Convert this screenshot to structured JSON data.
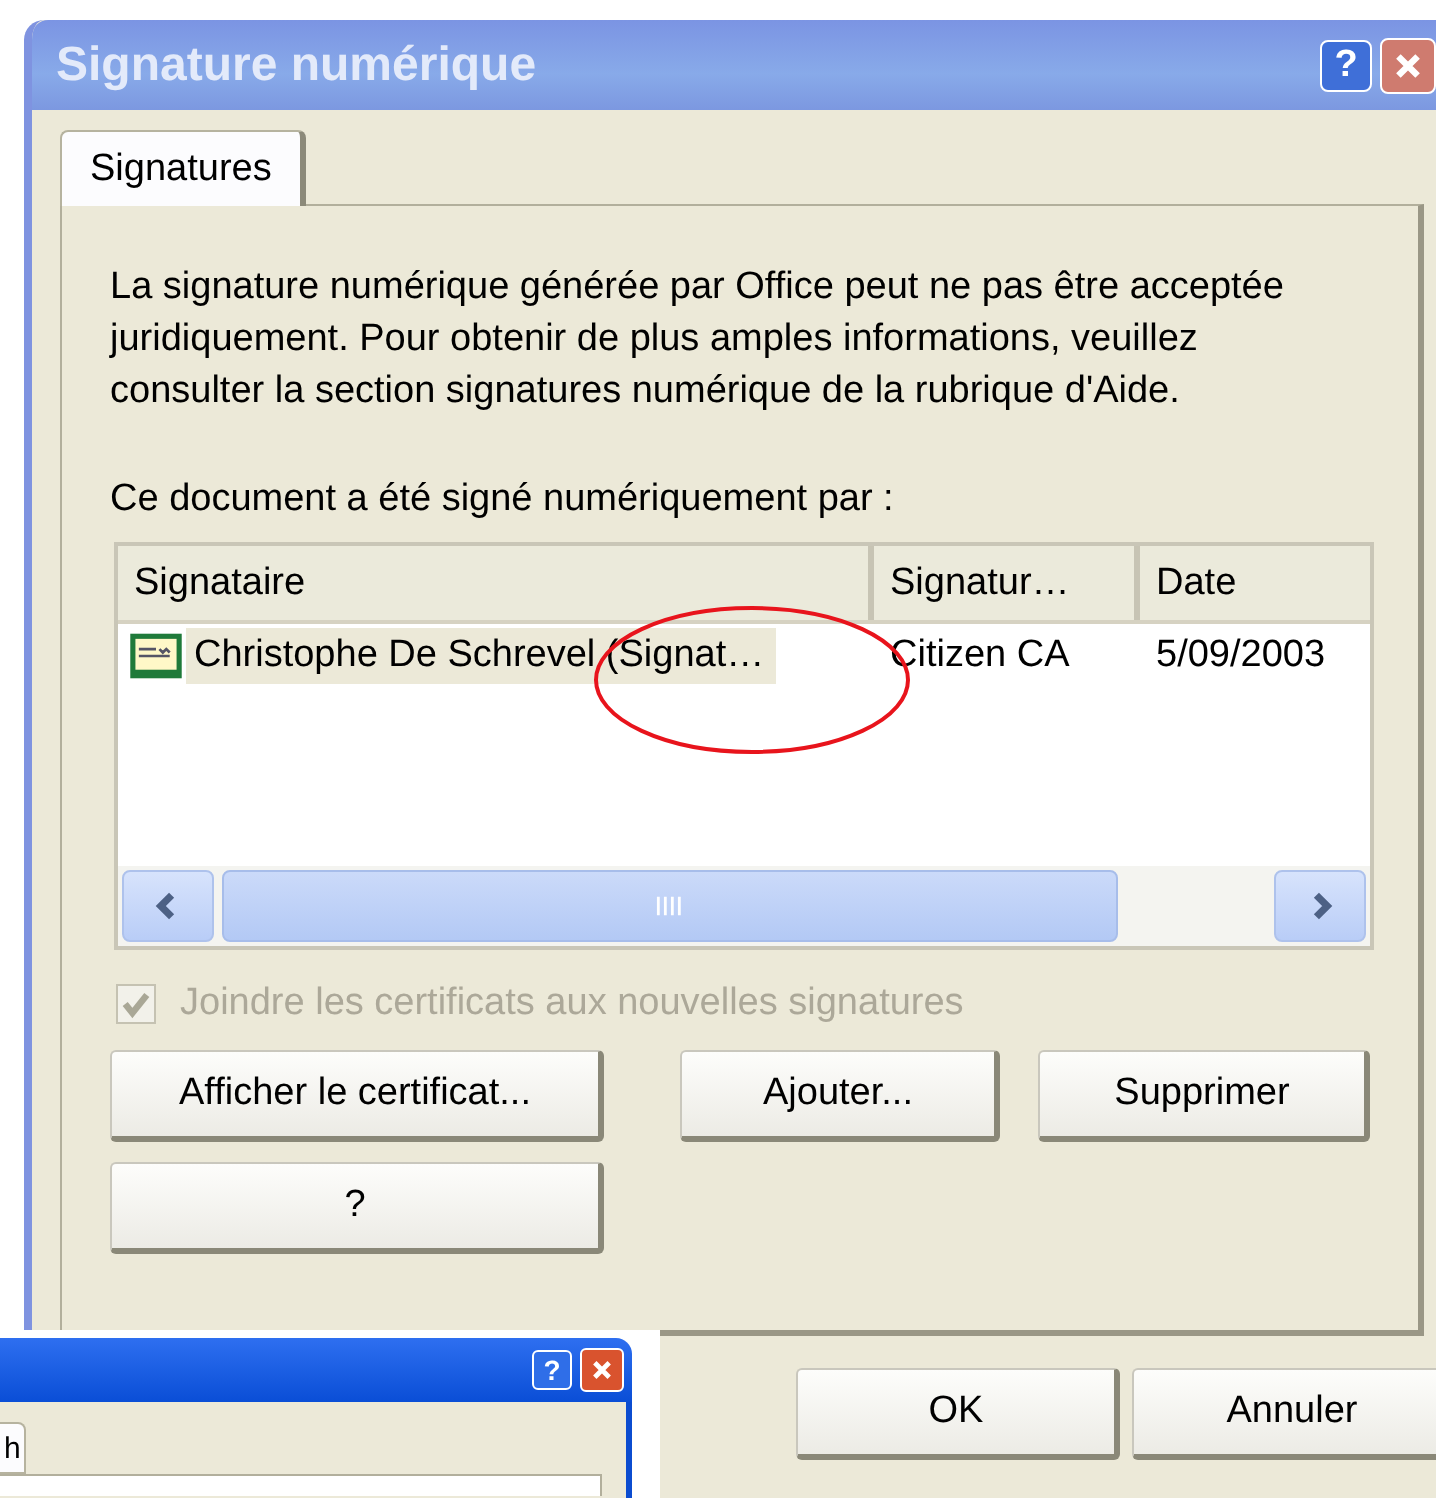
{
  "window": {
    "title": "Signature numérique",
    "help_button": "?"
  },
  "tabs": [
    {
      "label": "Signatures",
      "selected": true
    }
  ],
  "notice": "La signature numérique générée par Office peut ne pas être acceptée juridiquement. Pour obtenir de plus amples informations, veuillez consulter la section signatures numérique de la rubrique d'Aide.",
  "list_label": "Ce document a été signé numériquement par :",
  "table": {
    "columns": [
      "Signataire",
      "Signatur…",
      "Date"
    ],
    "rows": [
      {
        "cells": [
          "Christophe De Schrevel (Signat…",
          "Citizen CA",
          "5/09/2003"
        ],
        "selected": true
      }
    ]
  },
  "checkbox": {
    "label": "Joindre les certificats aux nouvelles signatures",
    "checked": true,
    "disabled": true
  },
  "action_buttons": [
    "Afficher le certificat...",
    "Ajouter...",
    "Supprimer"
  ],
  "help_button": "?",
  "dialog_buttons": [
    "OK",
    "Annuler"
  ],
  "background_window": {
    "help_button": "?",
    "tabs": [
      {
        "label": "h",
        "selected": true
      }
    ]
  }
}
